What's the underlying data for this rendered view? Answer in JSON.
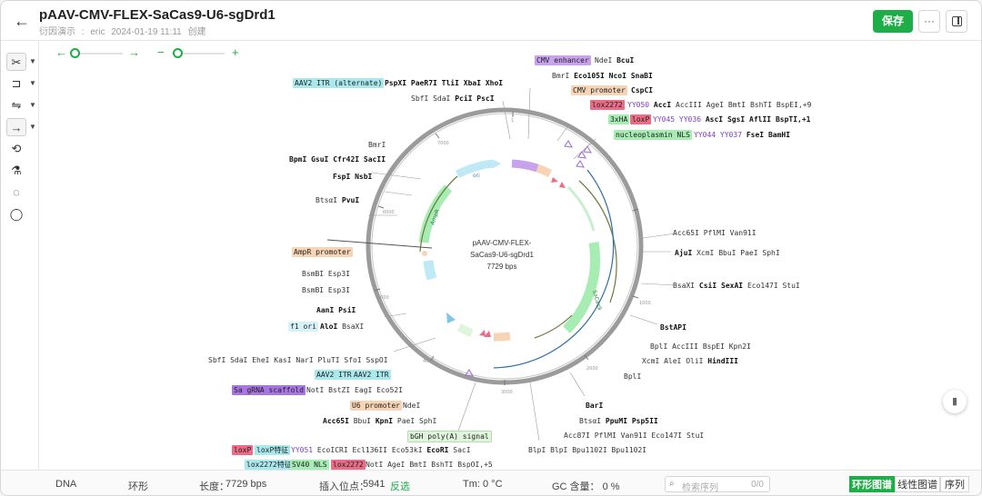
{
  "header": {
    "title": "pAAV-CMV-FLEX-SaCas9-U6-sgDrd1",
    "meta": [
      "衍因演示",
      "eric",
      "2024-01-19 11:11",
      "创建"
    ],
    "save_label": "保存",
    "more_label": "···"
  },
  "map": {
    "center_lines": [
      "pAAV-CMV-FLEX-",
      "SaCas9-U6-sgDrd1",
      "7729 bps"
    ],
    "ticks": [
      "1",
      "7000",
      "6000",
      "5000",
      "4000",
      "3000",
      "2000",
      "1000"
    ],
    "features": [
      {
        "name": "CMV enhancer",
        "color": "#c8a2ec"
      },
      {
        "name": "AAV2 ITR (alternate)",
        "color": "#a9e8ec"
      },
      {
        "name": "CMV promoter",
        "color": "#f7d4b6"
      },
      {
        "name": "lox2272",
        "color": "#ec6b86"
      },
      {
        "name": "3xHA",
        "color": "#a6ecb3"
      },
      {
        "name": "loxP",
        "color": "#ec6b86"
      },
      {
        "name": "nucleoplasmin NLS",
        "color": "#a6ecb3"
      },
      {
        "name": "AmpR promoter",
        "color": "#f7d4b6"
      },
      {
        "name": "f1 ori",
        "color": "#bfe9f4"
      },
      {
        "name": "AAV2 ITR",
        "color": "#a9e8ec"
      },
      {
        "name": "Sa gRNA scaffold",
        "color": "#a975e0"
      },
      {
        "name": "U6 promoter",
        "color": "#f7d4b6"
      },
      {
        "name": "bGH poly(A) signal",
        "color": "#dff5dc"
      },
      {
        "name": "ori",
        "color": "#bfe9f4"
      },
      {
        "name": "AmpR",
        "color": "#a6ecb3"
      },
      {
        "name": "SaCas9",
        "color": "#a6ecb3"
      }
    ],
    "labels": {
      "l01": [
        "NdeI",
        "BcuI"
      ],
      "l02": [
        "PspXI",
        "PaeR7I",
        "TliI",
        "XbaI",
        "XhoI"
      ],
      "l03": [
        "BmrI",
        "Eco105I",
        "NcoI",
        "SnaBI"
      ],
      "l04": [
        "SbfI",
        "SdaI",
        "PciI",
        "PscI"
      ],
      "l05": [
        "CspCI"
      ],
      "l06": [
        "YY050",
        "AccI",
        "AccIII",
        "AgeI",
        "BmtI",
        "BshTI",
        "BspEI,+9"
      ],
      "l07": [
        "YY045",
        "YY036",
        "AscI",
        "SgsI",
        "AflII",
        "BspTI,+1"
      ],
      "l08": [
        "YY044",
        "YY037",
        "FseI",
        "BamHI"
      ],
      "l09": [
        "BmrI"
      ],
      "l10": [
        "BpmI",
        "GsuI",
        "Cfr42I",
        "SacII"
      ],
      "l11": [
        "FspI",
        "NsbI"
      ],
      "l12": [
        "BtsαI",
        "PvuI"
      ],
      "l13": [
        "Acc65I",
        "PflMI",
        "Van91I"
      ],
      "l14": [
        "AjuI",
        "XcmI",
        "BbuI",
        "PaeI",
        "SphI"
      ],
      "l15": [
        "BsmBI",
        "Esp3I"
      ],
      "l16": [
        "BsmBI",
        "Esp3I"
      ],
      "l17": [
        "BsaXI",
        "CsiI",
        "SexAI",
        "Eco147I",
        "StuI"
      ],
      "l18": [
        "AanI",
        "PsiI"
      ],
      "l19": [
        "AloI",
        "BsaXI"
      ],
      "l20": [
        "BstAPI"
      ],
      "l21": [
        "BplI",
        "AccIII",
        "BspEI",
        "Kpn2I"
      ],
      "l22": [
        "SbfI",
        "SdaI",
        "EheI",
        "KasI",
        "NarI",
        "PluTI",
        "SfoI",
        "SspOI"
      ],
      "l23": [
        "XcmI",
        "AleI",
        "OliI",
        "HindIII"
      ],
      "l24": [
        "AAV2 ITR"
      ],
      "l25": [
        "BplI"
      ],
      "l26": [
        "NotI",
        "BstZI",
        "EagI",
        "Eco52I"
      ],
      "l27": [
        "NdeI"
      ],
      "l28": [
        "BarI"
      ],
      "l29": [
        "Acc65I",
        "BbuI",
        "KpnI",
        "PaeI",
        "SphI"
      ],
      "l30": [
        "BtsαI",
        "PpuMI",
        "Psp5II"
      ],
      "l31": [
        "Acc87I",
        "PflMI",
        "Van91I",
        "Eco147I",
        "StuI"
      ],
      "l32": [
        "loxP特征",
        "YY051",
        "EcoICRI",
        "Ecl136II",
        "Eco53kI",
        "EcoRI",
        "SacI"
      ],
      "l33": [
        "BlpI",
        "BlpI",
        "Bpu1102I",
        "Bpu1102I"
      ],
      "l34": [
        "lox2272特征",
        "SV40 NLS",
        "NotI",
        "AgeI",
        "BmtI",
        "BshTI",
        "BspOI,+5"
      ]
    }
  },
  "status": {
    "type": "DNA",
    "topology": "环形",
    "length_label": "长度：",
    "length_value": "7729 bps",
    "insert_label": "插入位点：",
    "insert_value": "5941",
    "insert_dir": "反选",
    "tm": "Tm: 0 °C",
    "gc": "GC 含量：  0 %",
    "search_placeholder": "检索序列",
    "search_count": "0/0",
    "tabs": [
      "环形图谱",
      "线性图谱",
      "序列"
    ]
  }
}
